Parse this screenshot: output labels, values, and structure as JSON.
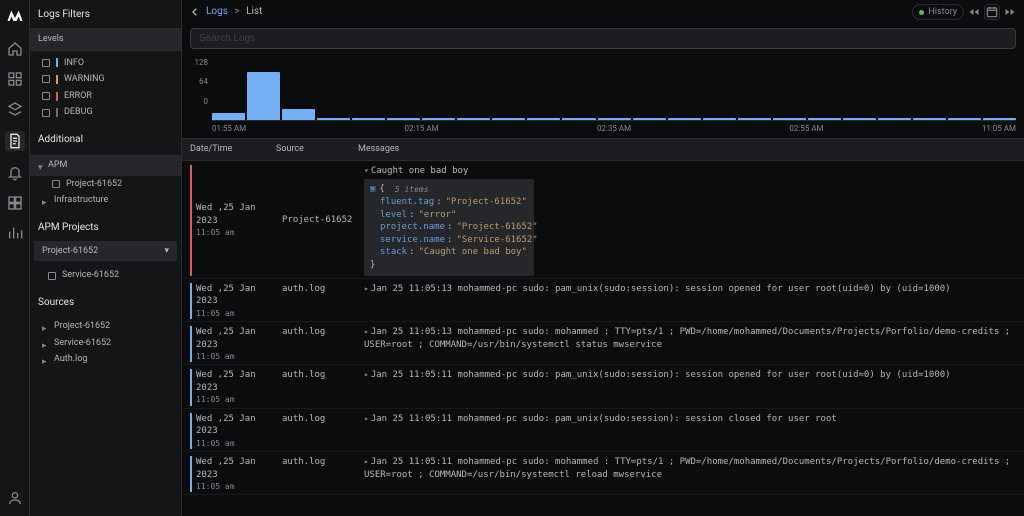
{
  "rail": {
    "icons": [
      "home",
      "dashboards",
      "apm",
      "logs",
      "alerts",
      "integrations",
      "metrics"
    ]
  },
  "filters": {
    "title": "Logs Filters",
    "levels_header": "Levels",
    "levels": [
      {
        "label": "INFO",
        "color": "#76aef4"
      },
      {
        "label": "WARNING",
        "color": "#e09d49"
      },
      {
        "label": "ERROR",
        "color": "#e05a58"
      },
      {
        "label": "DEBUG",
        "color": "#6d6f76"
      }
    ],
    "additional_header": "Additional",
    "additional": [
      {
        "label": "APM",
        "expandable": true
      },
      {
        "label": "Project-61652",
        "checkbox": true,
        "indent": 1
      },
      {
        "label": "Infrastructure",
        "expandable": true
      }
    ],
    "apm_projects_header": "APM Projects",
    "apm_project": "Project-61652",
    "apm_services": [
      {
        "label": "Service-61652"
      }
    ],
    "sources_header": "Sources",
    "sources": [
      {
        "label": "Project-61652"
      },
      {
        "label": "Service-61652"
      },
      {
        "label": "Auth.log"
      }
    ]
  },
  "topbar": {
    "crumb_parent": "Logs",
    "crumb_current": "List",
    "history_label": "History"
  },
  "search": {
    "placeholder": "Search Logs"
  },
  "chart_data": {
    "type": "bar",
    "categories": [
      "01:55 AM",
      "",
      "",
      "",
      "",
      "02:15 AM",
      "",
      "",
      "",
      "",
      "02:35 AM",
      "",
      "",
      "",
      "",
      "02:55 AM",
      "",
      "",
      "",
      "",
      "",
      "",
      "11:05 AM"
    ],
    "values": [
      18,
      128,
      30,
      4,
      4,
      4,
      4,
      4,
      4,
      4,
      4,
      4,
      4,
      4,
      4,
      4,
      4,
      4,
      4,
      4,
      4,
      4,
      4
    ],
    "title": "",
    "xlabel": "",
    "ylabel": "",
    "ylim": [
      0,
      128
    ],
    "y_ticks": [
      128,
      64,
      0
    ],
    "x_ticks": [
      "01:55 AM",
      "02:15 AM",
      "02:35 AM",
      "02:55 AM",
      "11:05 AM"
    ]
  },
  "table": {
    "columns": [
      "Date/Time",
      "Source",
      "Messages"
    ],
    "rows": [
      {
        "level": "error",
        "date": "Wed ,25 Jan 2023",
        "time": "11:05 am",
        "source": "Project-61652",
        "expanded": true,
        "summary": "Caught one bad boy",
        "json": {
          "count_label": "5 items",
          "fields": [
            {
              "k": "fluent.tag",
              "v": "Project-61652"
            },
            {
              "k": "level",
              "v": "error"
            },
            {
              "k": "project.name",
              "v": "Project-61652"
            },
            {
              "k": "service.name",
              "v": "Service-61652"
            },
            {
              "k": "stack",
              "v": "Caught one bad boy"
            }
          ]
        }
      },
      {
        "level": "info",
        "date": "Wed ,25 Jan 2023",
        "time": "11:05 am",
        "source": "auth.log",
        "message": "Jan 25 11:05:13 mohammed-pc sudo: pam_unix(sudo:session): session opened for user root(uid=0) by (uid=1000)"
      },
      {
        "level": "info",
        "date": "Wed ,25 Jan 2023",
        "time": "11:05 am",
        "source": "auth.log",
        "message": "Jan 25 11:05:13 mohammed-pc sudo: mohammed : TTY=pts/1 ; PWD=/home/mohammed/Documents/Projects/Porfolio/demo-credits ; USER=root ; COMMAND=/usr/bin/systemctl status mwservice"
      },
      {
        "level": "info",
        "date": "Wed ,25 Jan 2023",
        "time": "11:05 am",
        "source": "auth.log",
        "message": "Jan 25 11:05:11 mohammed-pc sudo: pam_unix(sudo:session): session opened for user root(uid=0) by (uid=1000)"
      },
      {
        "level": "info",
        "date": "Wed ,25 Jan 2023",
        "time": "11:05 am",
        "source": "auth.log",
        "message": "Jan 25 11:05:11 mohammed-pc sudo: pam_unix(sudo:session): session closed for user root"
      },
      {
        "level": "info",
        "date": "Wed ,25 Jan 2023",
        "time": "11:05 am",
        "source": "auth.log",
        "message": "Jan 25 11:05:11 mohammed-pc sudo: mohammed : TTY=pts/1 ; PWD=/home/mohammed/Documents/Projects/Porfolio/demo-credits ; USER=root ; COMMAND=/usr/bin/systemctl reload mwservice"
      }
    ]
  },
  "colors": {
    "level": {
      "info": "#76aef4",
      "warning": "#e09d49",
      "error": "#e05a58",
      "debug": "#6d6f76"
    }
  }
}
